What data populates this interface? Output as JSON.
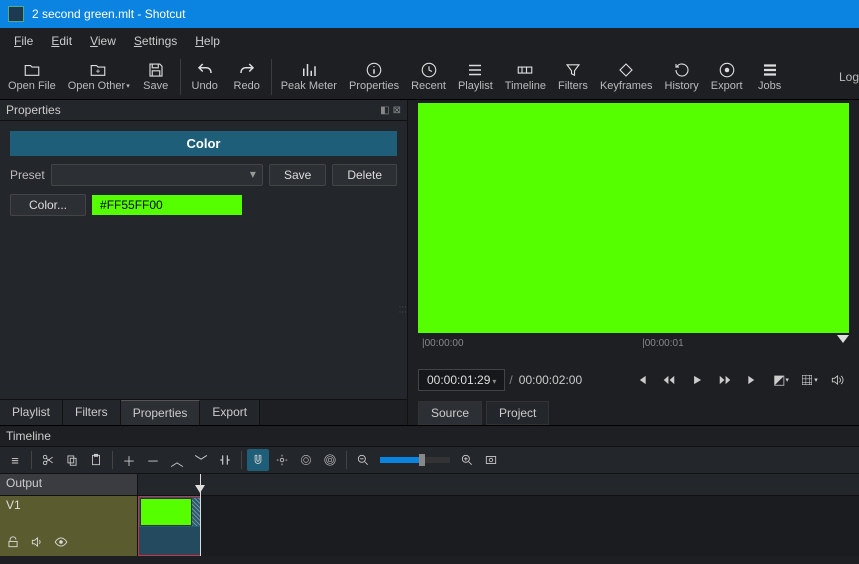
{
  "window": {
    "title": "2 second green.mlt - Shotcut"
  },
  "menubar": [
    "File",
    "Edit",
    "View",
    "Settings",
    "Help"
  ],
  "toolbar": [
    {
      "id": "open-file",
      "label": "Open File",
      "icon": "folder"
    },
    {
      "id": "open-other",
      "label": "Open Other",
      "icon": "folder-plus",
      "dd": true
    },
    {
      "id": "save",
      "label": "Save",
      "icon": "save"
    },
    {
      "sep": true
    },
    {
      "id": "undo",
      "label": "Undo",
      "icon": "undo"
    },
    {
      "id": "redo",
      "label": "Redo",
      "icon": "redo"
    },
    {
      "sep": true
    },
    {
      "id": "peak-meter",
      "label": "Peak Meter",
      "icon": "meter"
    },
    {
      "id": "properties",
      "label": "Properties",
      "icon": "info"
    },
    {
      "id": "recent",
      "label": "Recent",
      "icon": "clock"
    },
    {
      "id": "playlist",
      "label": "Playlist",
      "icon": "list"
    },
    {
      "id": "timeline",
      "label": "Timeline",
      "icon": "timeline"
    },
    {
      "id": "filters",
      "label": "Filters",
      "icon": "funnel"
    },
    {
      "id": "keyframes",
      "label": "Keyframes",
      "icon": "keyframe"
    },
    {
      "id": "history",
      "label": "History",
      "icon": "history"
    },
    {
      "id": "export",
      "label": "Export",
      "icon": "disc"
    },
    {
      "id": "jobs",
      "label": "Jobs",
      "icon": "stack"
    }
  ],
  "right_cut": "Log",
  "properties": {
    "panel_title": "Properties",
    "color_title": "Color",
    "preset_label": "Preset",
    "save_btn": "Save",
    "delete_btn": "Delete",
    "color_btn": "Color...",
    "color_value": "#FF55FF00",
    "swatch_color": "#55ff00",
    "tabs": [
      "Playlist",
      "Filters",
      "Properties",
      "Export"
    ],
    "active_tab": 2
  },
  "preview": {
    "ruler": [
      "00:00:00",
      "00:00:01"
    ],
    "timecode": "00:00:01:29",
    "duration": "00:00:02:00",
    "src_proj": [
      "Source",
      "Project"
    ],
    "src_proj_active": 0,
    "green_color": "#55ff00"
  },
  "timeline": {
    "title": "Timeline",
    "output_label": "Output",
    "track_label": "V1"
  }
}
